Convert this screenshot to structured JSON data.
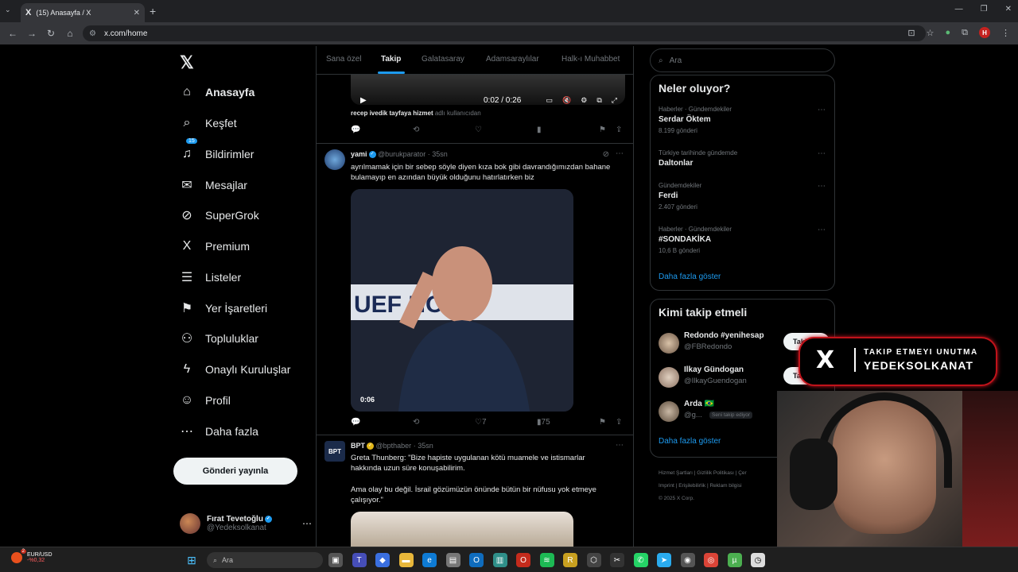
{
  "browser": {
    "tab_title": "(15) Anasayfa / X",
    "tab_icon": "X",
    "url": "x.com/home",
    "profile_initial": "H"
  },
  "nav": {
    "items": [
      {
        "label": "Anasayfa",
        "icon": "home-icon",
        "glyph": "⌂",
        "active": true
      },
      {
        "label": "Keşfet",
        "icon": "search-icon",
        "glyph": "⌕"
      },
      {
        "label": "Bildirimler",
        "icon": "bell-icon",
        "glyph": "♫",
        "badge": "15"
      },
      {
        "label": "Mesajlar",
        "icon": "mail-icon",
        "glyph": "✉"
      },
      {
        "label": "SuperGrok",
        "icon": "grok-icon",
        "glyph": "⊘"
      },
      {
        "label": "Premium",
        "icon": "x-premium-icon",
        "glyph": "X"
      },
      {
        "label": "Listeler",
        "icon": "list-icon",
        "glyph": "☰"
      },
      {
        "label": "Yer İşaretleri",
        "icon": "bookmark-icon",
        "glyph": "⚑"
      },
      {
        "label": "Topluluklar",
        "icon": "communities-icon",
        "glyph": "⚇"
      },
      {
        "label": "Onaylı Kuruluşlar",
        "icon": "lightning-icon",
        "glyph": "ϟ"
      },
      {
        "label": "Profil",
        "icon": "person-icon",
        "glyph": "☺"
      },
      {
        "label": "Daha fazla",
        "icon": "more-circle-icon",
        "glyph": "⋯"
      }
    ],
    "post_button": "Gönderi yayınla",
    "account": {
      "name": "Fırat Tevetoğlu",
      "handle": "@Yedeksolkanat"
    }
  },
  "feed": {
    "tabs": [
      "Sana özel",
      "Takip",
      "Galatasaray",
      "Adamsaraylılar",
      "Halk-ı Muhabbet"
    ],
    "active_tab": "Takip",
    "video1": {
      "time": "0:02 / 0:26"
    },
    "caption1": {
      "bold": "recep ivedik tayfaya hizmet",
      "muted": "adlı kullanıcıdan"
    },
    "tweet2": {
      "name": "yami",
      "handle": "@burukparator",
      "time": "· 35sn",
      "text": "ayrılmamak için bir sebep söyle diyen kıza bok gibi davrandığımızdan bahane bulamayıp en azından büyük olduğunu hatırlatırken biz",
      "duration": "0:06",
      "likes": "7",
      "views": "75"
    },
    "tweet3": {
      "name": "BPT",
      "handle": "@bpthaber",
      "time": "· 35sn",
      "text1": "Greta Thunberg: \"Bize hapiste uygulanan kötü muamele ve istismarlar hakkında uzun süre konuşabilirim.",
      "text2": "Ama olay bu değil. İsrail gözümüzün önünde bütün bir nüfusu yok etmeye çalışıyor.\""
    }
  },
  "right": {
    "search_placeholder": "Ara",
    "trends_title": "Neler oluyor?",
    "trends": [
      {
        "meta": "Haberler · Gündemdekiler",
        "name": "Serdar Öktem",
        "count": "8.199 gönderi"
      },
      {
        "meta": "Türkiye tarihinde gündemde",
        "name": "Daltonlar",
        "count": ""
      },
      {
        "meta": "Gündemdekiler",
        "name": "Ferdi",
        "count": "2.407 gönderi"
      },
      {
        "meta": "Haberler · Gündemdekiler",
        "name": "#SONDAKİKA",
        "count": "10,6 B gönderi"
      }
    ],
    "trends_more": "Daha fazla göster",
    "who_title": "Kimi takip etmeli",
    "who": [
      {
        "name": "Redondo #yenihesap",
        "handle": "@FBRedondo",
        "button": "Takip"
      },
      {
        "name": "Ilkay Gündogan",
        "handle": "@IlkayGuendogan",
        "button": "Takip"
      },
      {
        "name": "Arda 🇧🇷",
        "handle": "@g...",
        "button": "G",
        "follows_you": "Seni takip ediyor"
      }
    ],
    "who_more": "Daha fazla göster",
    "footer": [
      "Hizmet Şartları",
      "Gizlilik Politikası",
      "Çer",
      "Imprint",
      "Erişilebilirlik",
      "Reklam bilgisi",
      "© 2025 X Corp."
    ]
  },
  "overlay": {
    "line1": "TAKIP ETMEYI UNUTMA",
    "line2": "YEDEKSOLKANAT"
  },
  "taskbar": {
    "ticker": "EUR/USD",
    "ticker_change": "-%0,32",
    "ticker_badge": "2",
    "search_placeholder": "Ara"
  },
  "colors": {
    "accent": "#1d9bf0",
    "background": "#000000",
    "overlay_red": "#c0131a"
  }
}
